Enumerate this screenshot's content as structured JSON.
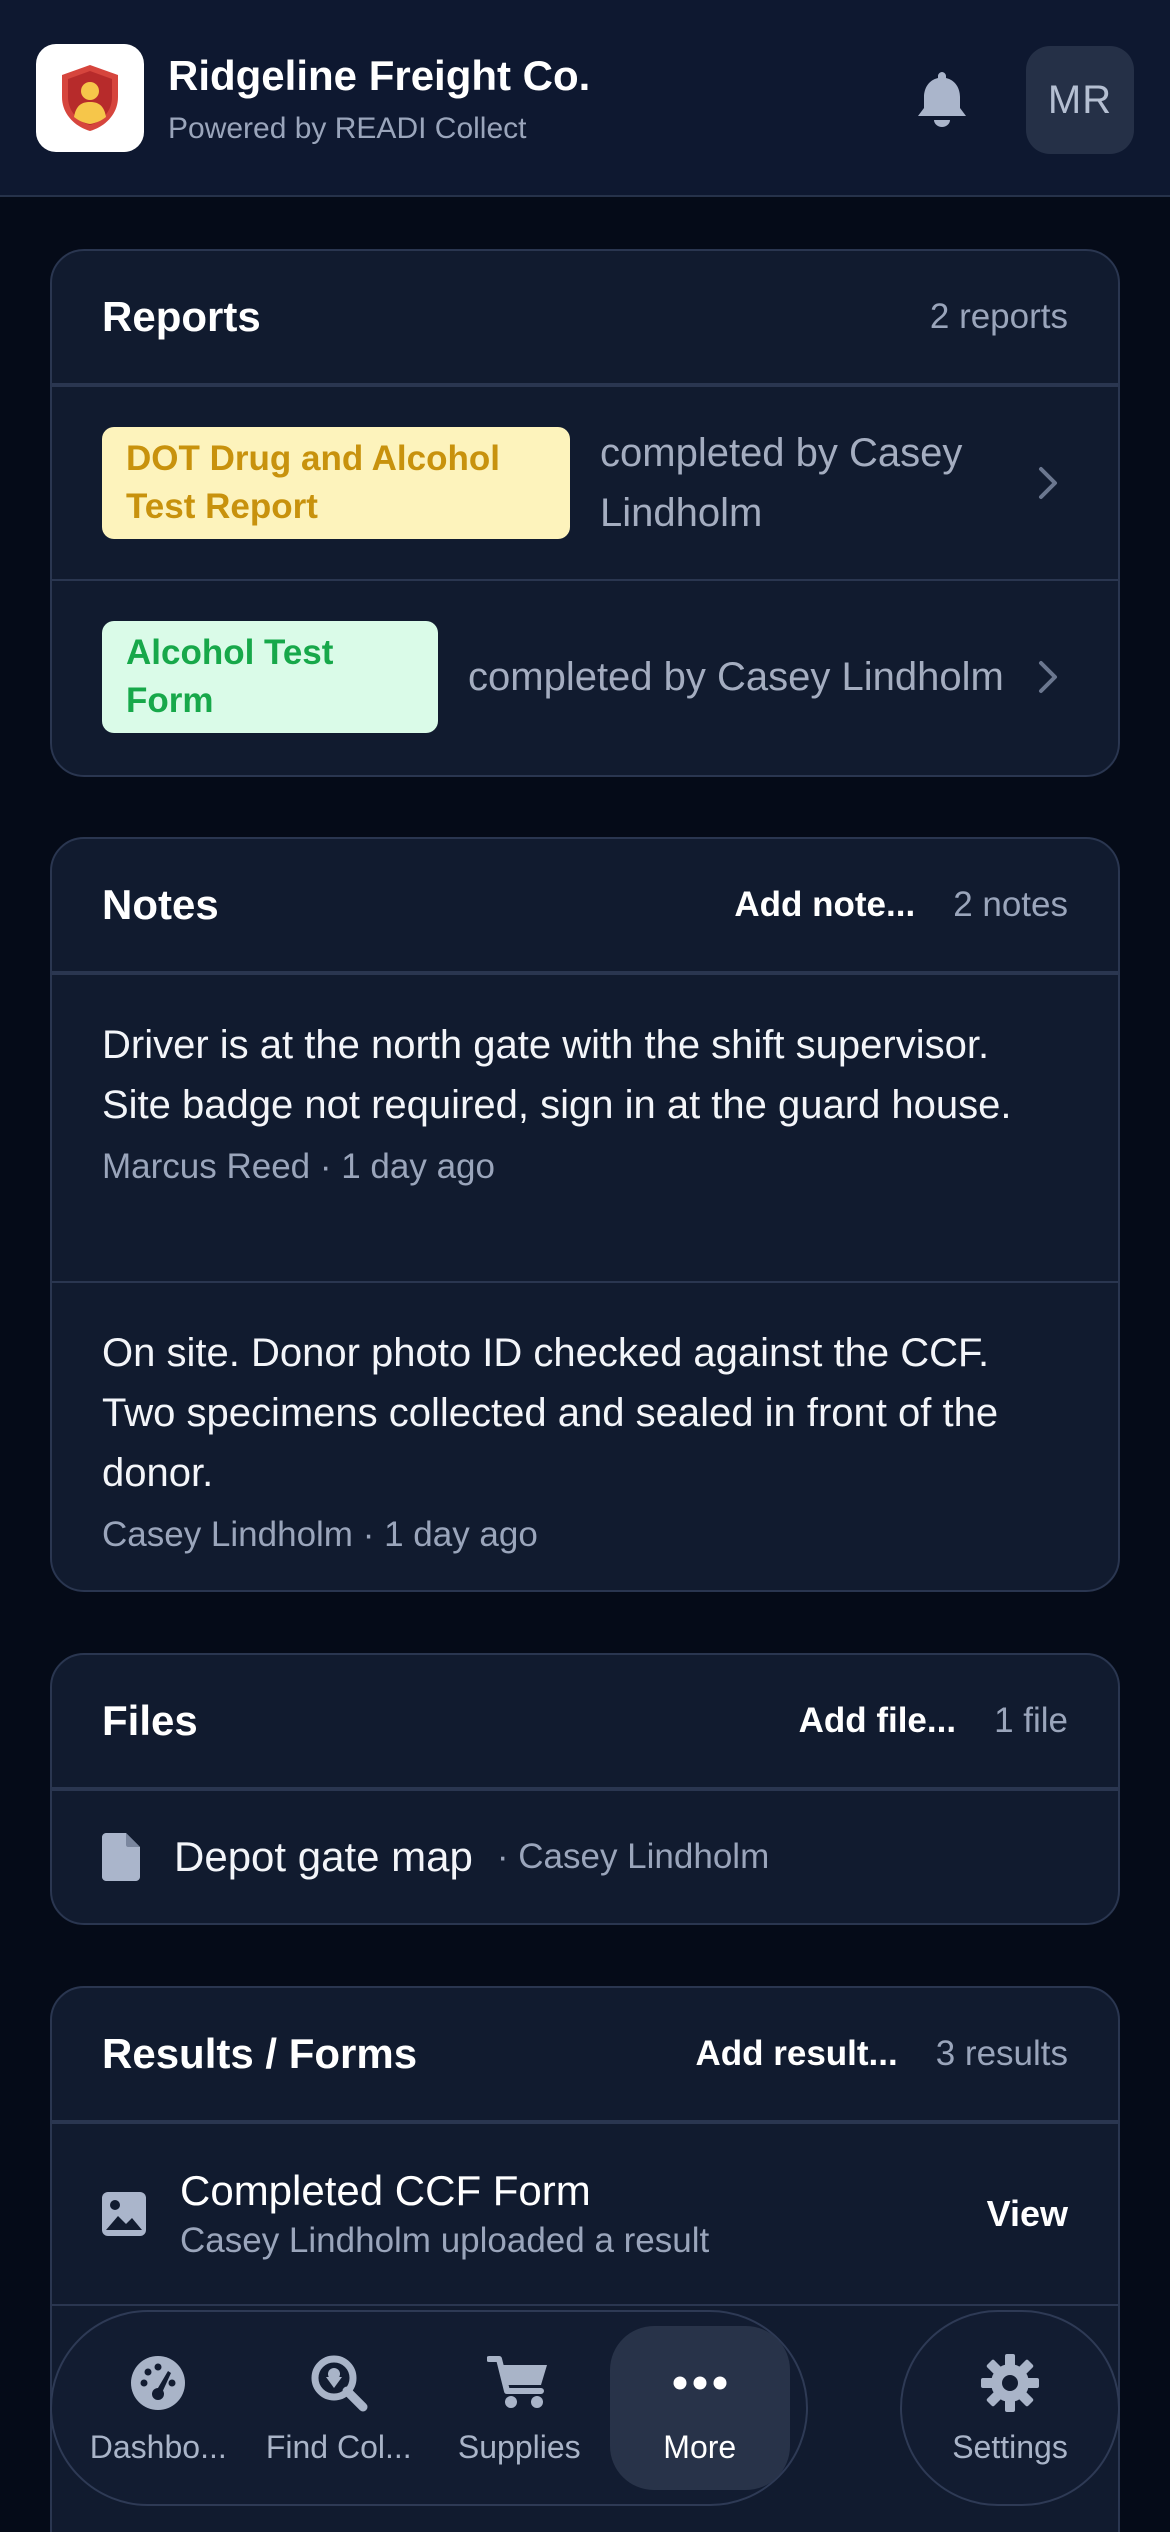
{
  "header": {
    "title": "Ridgeline Freight Co.",
    "subtitle": "Powered by READI Collect",
    "avatar_initials": "MR",
    "icons": {
      "logo": "shield-person-logo",
      "notifications": "bell-icon"
    }
  },
  "reports": {
    "title": "Reports",
    "count": "2 reports",
    "items": [
      {
        "tag": "DOT Drug and Alcohol Test Report",
        "completed_by": "completed by Casey Lindholm",
        "tag_color": "#fdf3bc",
        "tag_text_color": "#c8920d"
      },
      {
        "tag": "Alcohol Test Form",
        "completed_by": "completed by Casey Lindholm",
        "tag_color": "#dafbe8",
        "tag_text_color": "#17a84a"
      }
    ]
  },
  "notes": {
    "title": "Notes",
    "add_label": "Add note...",
    "count": "2 notes",
    "items": [
      {
        "text": "Driver is at the north gate with the shift supervisor. Site badge not required, sign in at the guard house.",
        "meta": "Marcus Reed · 1 day ago"
      },
      {
        "text": "On site. Donor photo ID checked against the CCF. Two specimens collected and sealed in front of the donor.",
        "meta": "Casey Lindholm · 1 day ago"
      }
    ]
  },
  "files": {
    "title": "Files",
    "add_label": "Add file...",
    "count": "1 file",
    "items": [
      {
        "name": "Depot gate map",
        "by": "· Casey Lindholm",
        "icon": "document-icon"
      }
    ]
  },
  "results": {
    "title": "Results / Forms",
    "add_label": "Add result...",
    "count": "3 results",
    "items": [
      {
        "title": "Completed CCF Form",
        "subtitle": "Casey Lindholm uploaded a result",
        "action": "View",
        "icon": "image-icon"
      }
    ]
  },
  "nav": {
    "items": [
      {
        "label": "Dashbo...",
        "icon": "gauge-icon"
      },
      {
        "label": "Find Col...",
        "icon": "search-location-icon"
      },
      {
        "label": "Supplies",
        "icon": "cart-icon"
      },
      {
        "label": "More",
        "icon": "ellipsis-icon",
        "active": true
      }
    ],
    "settings": {
      "label": "Settings",
      "icon": "gear-icon"
    }
  },
  "colors": {
    "background": "#050b18",
    "card": "#111b2f",
    "border": "#2a3650",
    "muted_text": "#9aa5bb"
  }
}
